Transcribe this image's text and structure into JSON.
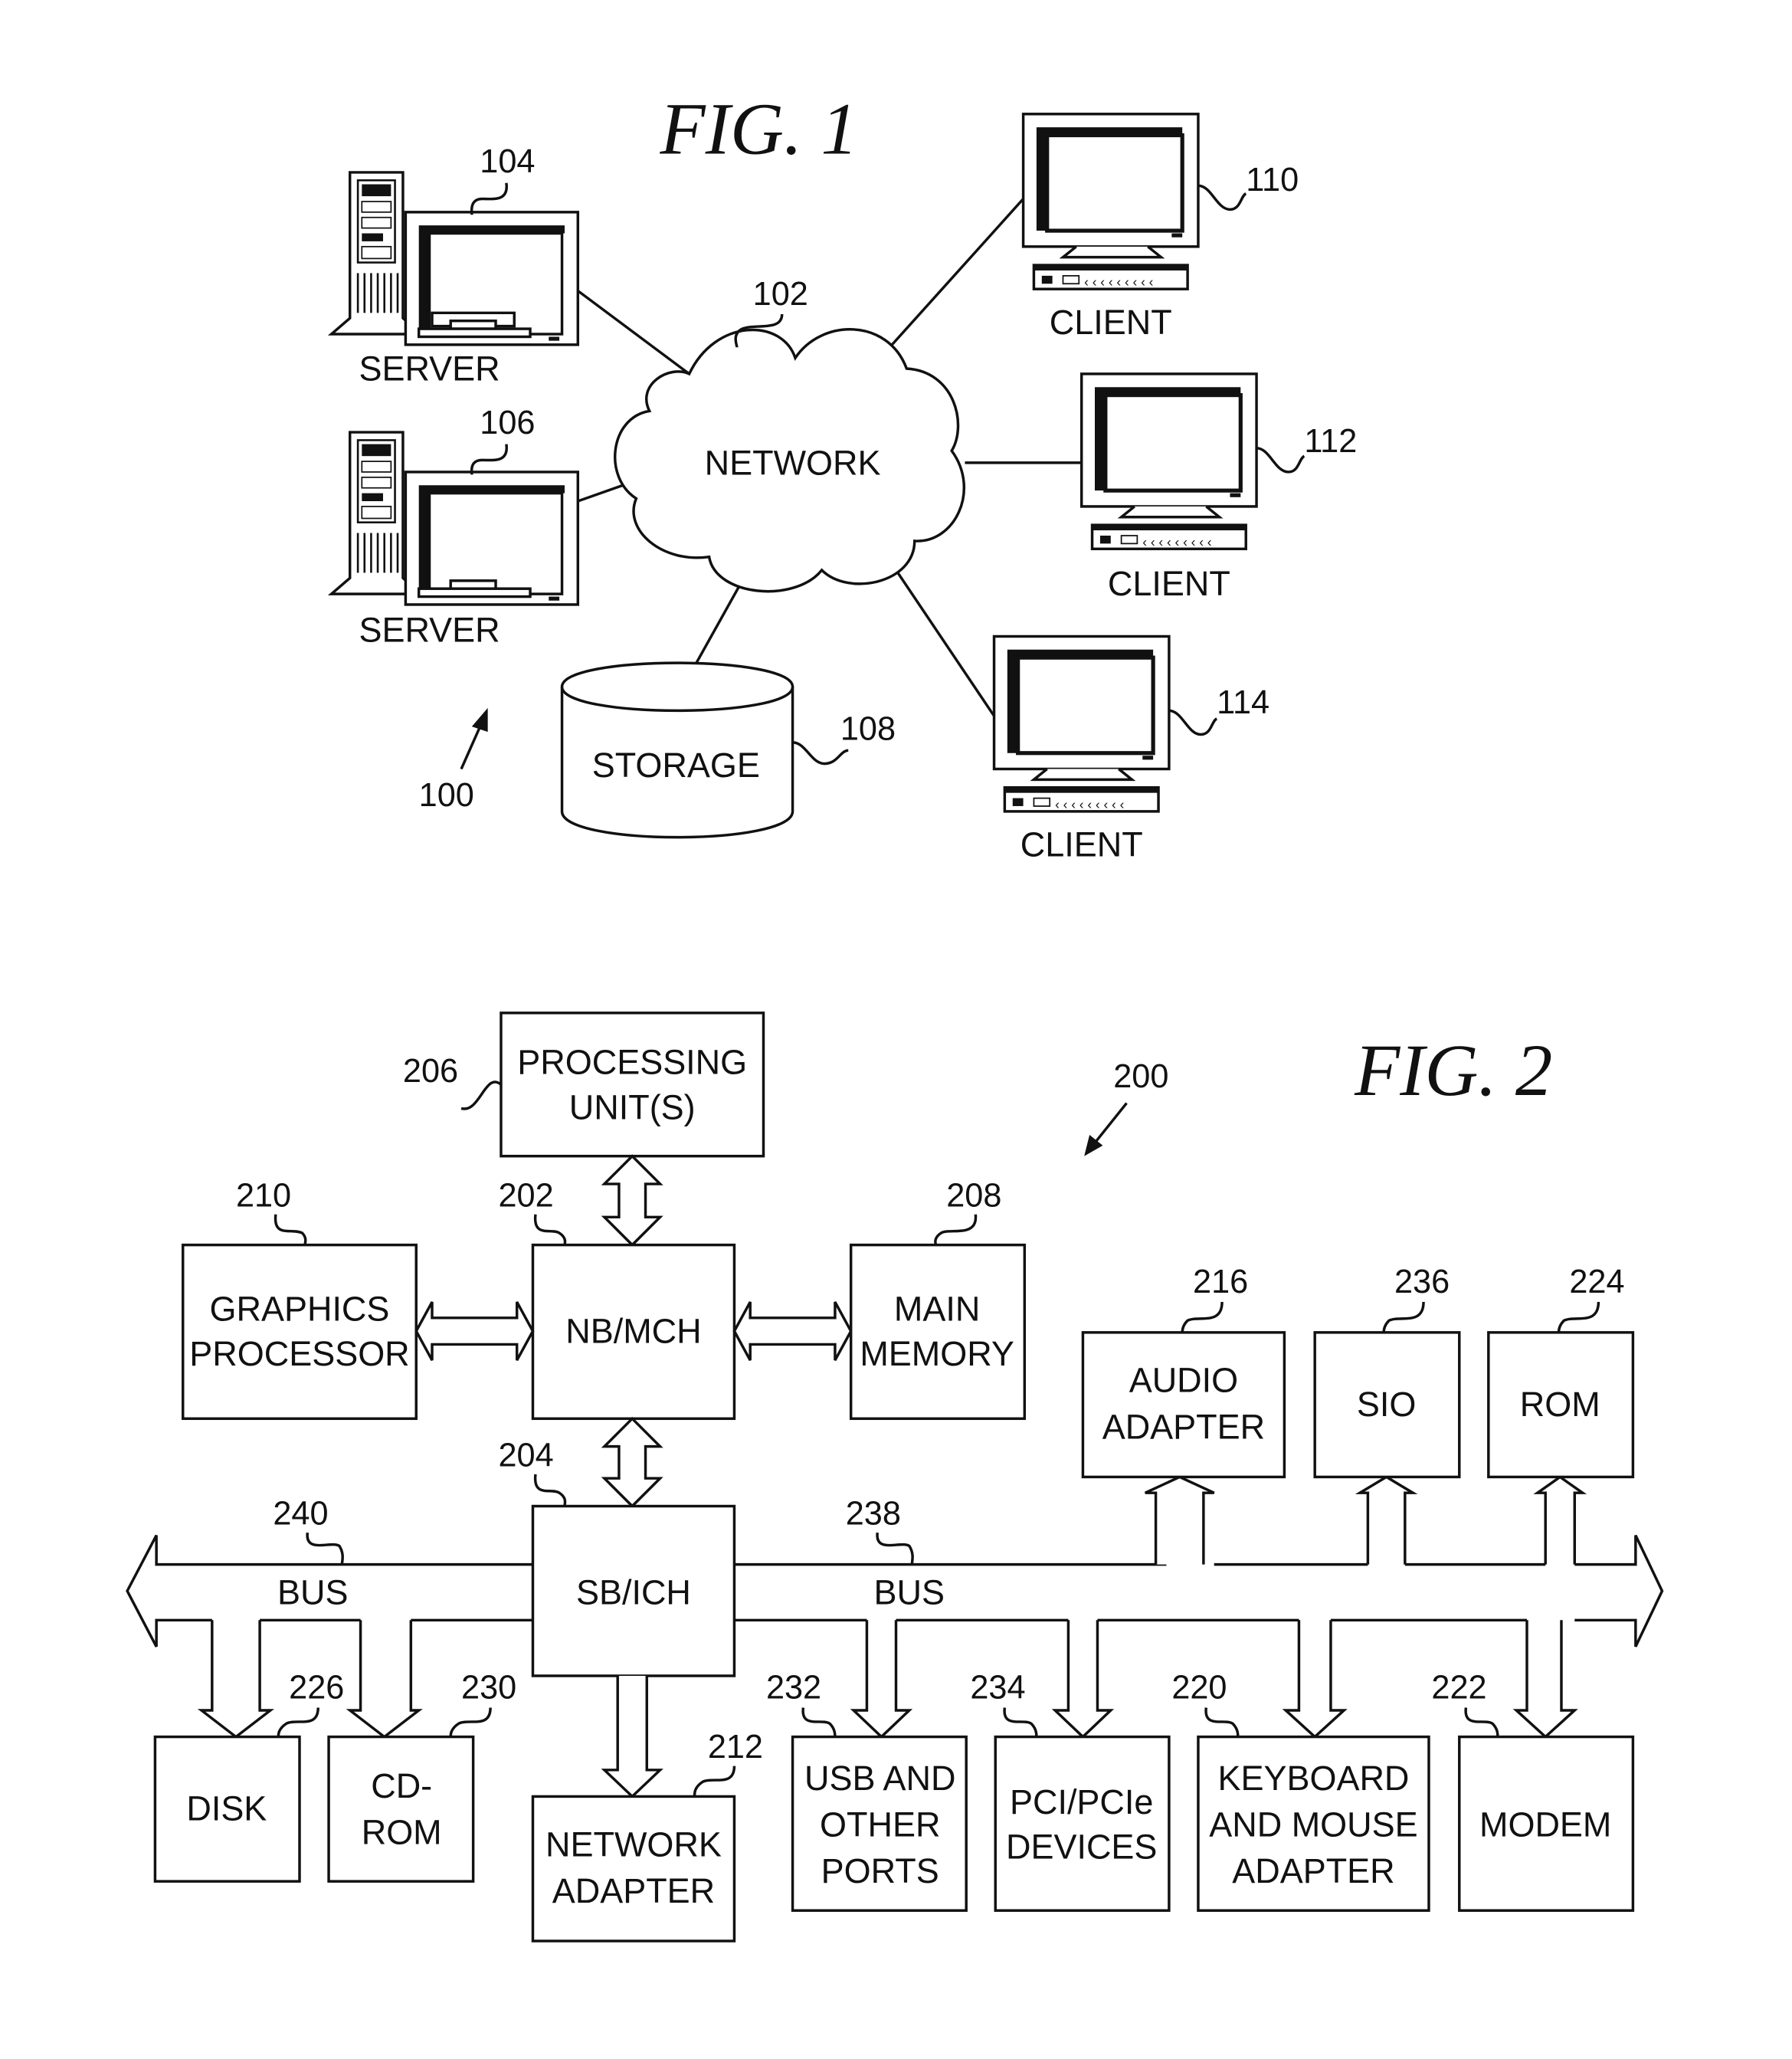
{
  "fig1": {
    "title": "FIG. 1",
    "system_ref": "100",
    "network": {
      "label": "NETWORK",
      "ref": "102"
    },
    "servers": [
      {
        "label": "SERVER",
        "ref": "104"
      },
      {
        "label": "SERVER",
        "ref": "106"
      }
    ],
    "storage": {
      "label": "STORAGE",
      "ref": "108"
    },
    "clients": [
      {
        "label": "CLIENT",
        "ref": "110"
      },
      {
        "label": "CLIENT",
        "ref": "112"
      },
      {
        "label": "CLIENT",
        "ref": "114"
      }
    ]
  },
  "fig2": {
    "title": "FIG. 2",
    "system_ref": "200",
    "processing_unit": {
      "line1": "PROCESSING",
      "line2": "UNIT(S)",
      "ref": "206"
    },
    "nb_mch": {
      "label": "NB/MCH",
      "ref": "202"
    },
    "graphics": {
      "line1": "GRAPHICS",
      "line2": "PROCESSOR",
      "ref": "210"
    },
    "main_memory": {
      "line1": "MAIN",
      "line2": "MEMORY",
      "ref": "208"
    },
    "sb_ich": {
      "label": "SB/ICH",
      "ref": "204"
    },
    "bus_left": {
      "label": "BUS",
      "ref": "240"
    },
    "bus_right": {
      "label": "BUS",
      "ref": "238"
    },
    "audio": {
      "line1": "AUDIO",
      "line2": "ADAPTER",
      "ref": "216"
    },
    "sio": {
      "label": "SIO",
      "ref": "236"
    },
    "rom": {
      "label": "ROM",
      "ref": "224"
    },
    "disk": {
      "label": "DISK",
      "ref": "226"
    },
    "cdrom": {
      "line1": "CD-",
      "line2": "ROM",
      "ref": "230"
    },
    "network_adapter": {
      "line1": "NETWORK",
      "line2": "ADAPTER",
      "ref": "212"
    },
    "usb": {
      "line1": "USB AND",
      "line2": "OTHER",
      "line3": "PORTS",
      "ref": "232"
    },
    "pci": {
      "line1": "PCI/PCIe",
      "line2": "DEVICES",
      "ref": "234"
    },
    "keyboard": {
      "line1": "KEYBOARD",
      "line2": "AND MOUSE",
      "line3": "ADAPTER",
      "ref": "220"
    },
    "modem": {
      "label": "MODEM",
      "ref": "222"
    }
  }
}
